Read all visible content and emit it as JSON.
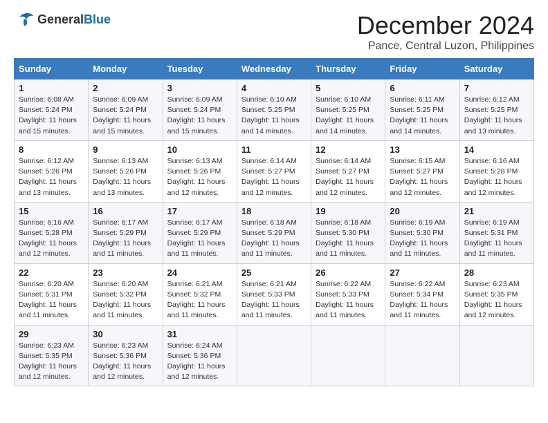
{
  "header": {
    "logo_general": "General",
    "logo_blue": "Blue",
    "month_title": "December 2024",
    "location": "Pance, Central Luzon, Philippines"
  },
  "weekdays": [
    "Sunday",
    "Monday",
    "Tuesday",
    "Wednesday",
    "Thursday",
    "Friday",
    "Saturday"
  ],
  "weeks": [
    [
      {
        "day": "1",
        "sunrise": "6:08 AM",
        "sunset": "5:24 PM",
        "daylight": "11 hours and 15 minutes."
      },
      {
        "day": "2",
        "sunrise": "6:09 AM",
        "sunset": "5:24 PM",
        "daylight": "11 hours and 15 minutes."
      },
      {
        "day": "3",
        "sunrise": "6:09 AM",
        "sunset": "5:24 PM",
        "daylight": "11 hours and 15 minutes."
      },
      {
        "day": "4",
        "sunrise": "6:10 AM",
        "sunset": "5:25 PM",
        "daylight": "11 hours and 14 minutes."
      },
      {
        "day": "5",
        "sunrise": "6:10 AM",
        "sunset": "5:25 PM",
        "daylight": "11 hours and 14 minutes."
      },
      {
        "day": "6",
        "sunrise": "6:11 AM",
        "sunset": "5:25 PM",
        "daylight": "11 hours and 14 minutes."
      },
      {
        "day": "7",
        "sunrise": "6:12 AM",
        "sunset": "5:25 PM",
        "daylight": "11 hours and 13 minutes."
      }
    ],
    [
      {
        "day": "8",
        "sunrise": "6:12 AM",
        "sunset": "5:26 PM",
        "daylight": "11 hours and 13 minutes."
      },
      {
        "day": "9",
        "sunrise": "6:13 AM",
        "sunset": "5:26 PM",
        "daylight": "11 hours and 13 minutes."
      },
      {
        "day": "10",
        "sunrise": "6:13 AM",
        "sunset": "5:26 PM",
        "daylight": "11 hours and 12 minutes."
      },
      {
        "day": "11",
        "sunrise": "6:14 AM",
        "sunset": "5:27 PM",
        "daylight": "11 hours and 12 minutes."
      },
      {
        "day": "12",
        "sunrise": "6:14 AM",
        "sunset": "5:27 PM",
        "daylight": "11 hours and 12 minutes."
      },
      {
        "day": "13",
        "sunrise": "6:15 AM",
        "sunset": "5:27 PM",
        "daylight": "11 hours and 12 minutes."
      },
      {
        "day": "14",
        "sunrise": "6:16 AM",
        "sunset": "5:28 PM",
        "daylight": "11 hours and 12 minutes."
      }
    ],
    [
      {
        "day": "15",
        "sunrise": "6:16 AM",
        "sunset": "5:28 PM",
        "daylight": "11 hours and 12 minutes."
      },
      {
        "day": "16",
        "sunrise": "6:17 AM",
        "sunset": "5:29 PM",
        "daylight": "11 hours and 11 minutes."
      },
      {
        "day": "17",
        "sunrise": "6:17 AM",
        "sunset": "5:29 PM",
        "daylight": "11 hours and 11 minutes."
      },
      {
        "day": "18",
        "sunrise": "6:18 AM",
        "sunset": "5:29 PM",
        "daylight": "11 hours and 11 minutes."
      },
      {
        "day": "19",
        "sunrise": "6:18 AM",
        "sunset": "5:30 PM",
        "daylight": "11 hours and 11 minutes."
      },
      {
        "day": "20",
        "sunrise": "6:19 AM",
        "sunset": "5:30 PM",
        "daylight": "11 hours and 11 minutes."
      },
      {
        "day": "21",
        "sunrise": "6:19 AM",
        "sunset": "5:31 PM",
        "daylight": "11 hours and 11 minutes."
      }
    ],
    [
      {
        "day": "22",
        "sunrise": "6:20 AM",
        "sunset": "5:31 PM",
        "daylight": "11 hours and 11 minutes."
      },
      {
        "day": "23",
        "sunrise": "6:20 AM",
        "sunset": "5:32 PM",
        "daylight": "11 hours and 11 minutes."
      },
      {
        "day": "24",
        "sunrise": "6:21 AM",
        "sunset": "5:32 PM",
        "daylight": "11 hours and 11 minutes."
      },
      {
        "day": "25",
        "sunrise": "6:21 AM",
        "sunset": "5:33 PM",
        "daylight": "11 hours and 11 minutes."
      },
      {
        "day": "26",
        "sunrise": "6:22 AM",
        "sunset": "5:33 PM",
        "daylight": "11 hours and 11 minutes."
      },
      {
        "day": "27",
        "sunrise": "6:22 AM",
        "sunset": "5:34 PM",
        "daylight": "11 hours and 11 minutes."
      },
      {
        "day": "28",
        "sunrise": "6:23 AM",
        "sunset": "5:35 PM",
        "daylight": "11 hours and 12 minutes."
      }
    ],
    [
      {
        "day": "29",
        "sunrise": "6:23 AM",
        "sunset": "5:35 PM",
        "daylight": "11 hours and 12 minutes."
      },
      {
        "day": "30",
        "sunrise": "6:23 AM",
        "sunset": "5:36 PM",
        "daylight": "11 hours and 12 minutes."
      },
      {
        "day": "31",
        "sunrise": "6:24 AM",
        "sunset": "5:36 PM",
        "daylight": "11 hours and 12 minutes."
      },
      null,
      null,
      null,
      null
    ]
  ]
}
